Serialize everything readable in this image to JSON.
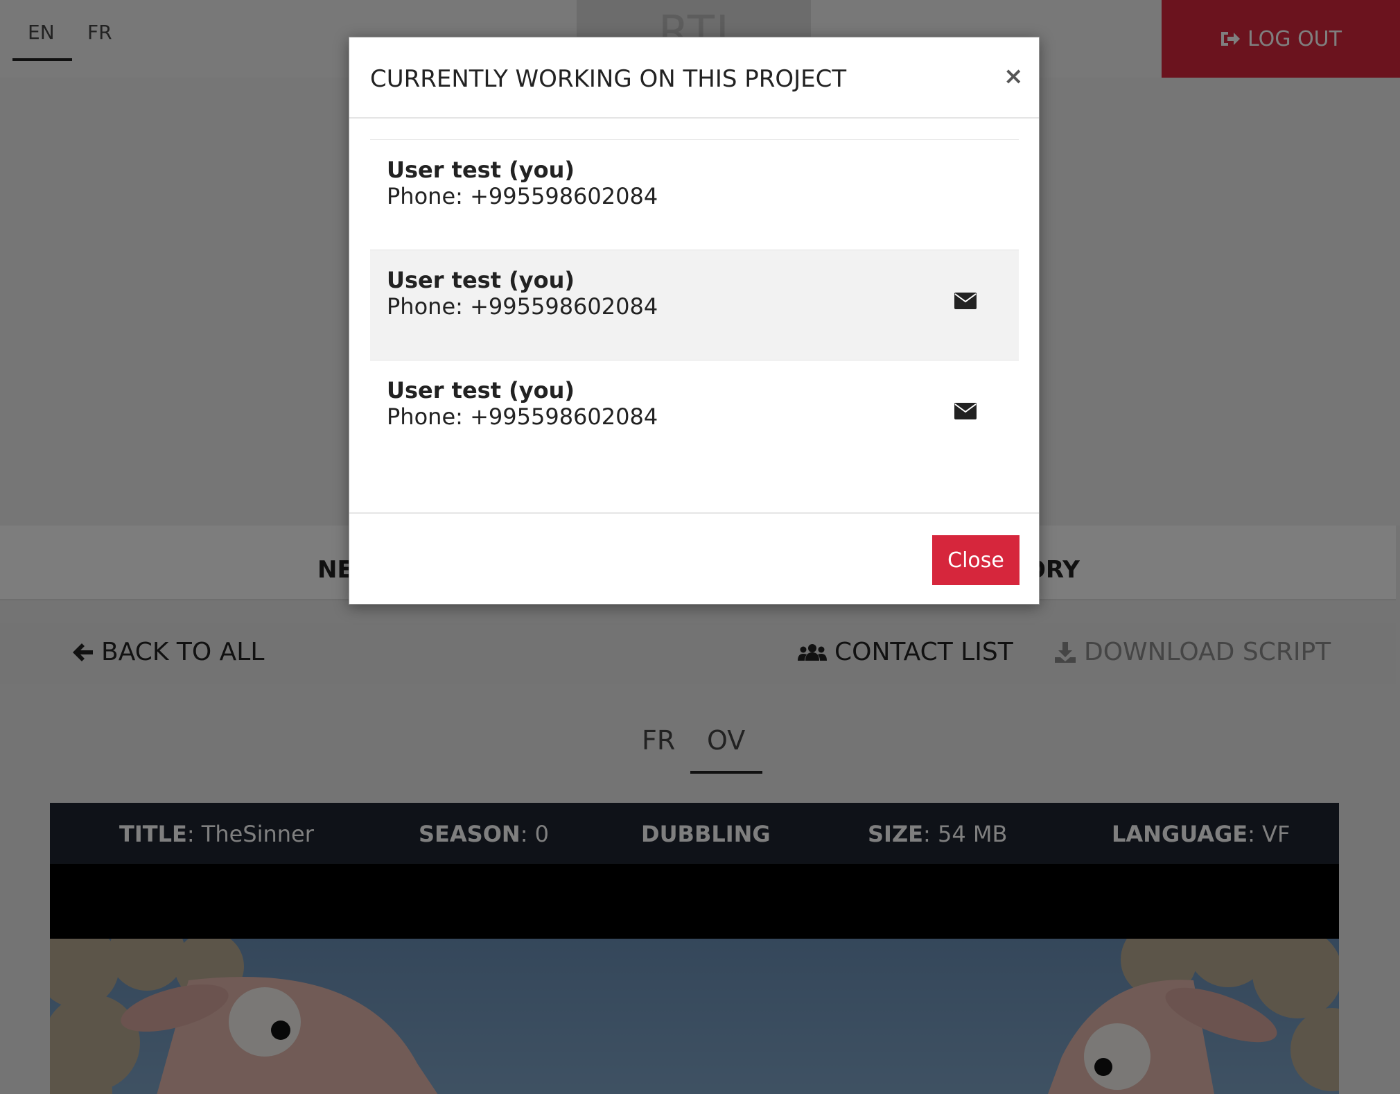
{
  "header": {
    "languages": [
      "EN",
      "FR"
    ],
    "logo_text": "RTI",
    "logout_label": "LOG OUT"
  },
  "tabs": {
    "left_partial": "NE",
    "right_partial": "ORY"
  },
  "actions": {
    "back_label": "BACK TO ALL",
    "contact_label": "CONTACT LIST",
    "download_label": "DOWNLOAD SCRIPT"
  },
  "versions": [
    "FR",
    "OV"
  ],
  "info": {
    "title_label": "TITLE",
    "title_value": "TheSinner",
    "season_label": "SEASON",
    "season_value": "0",
    "type_label": "DUBBLING",
    "size_label": "SIZE",
    "size_value": "54 MB",
    "language_label": "LANGUAGE",
    "language_value": "VF"
  },
  "modal": {
    "title": "CURRENTLY WORKING ON THIS PROJECT",
    "close_x": "×",
    "close_label": "Close",
    "users": [
      {
        "name": "User test (you)",
        "phone": "Phone: +995598602084"
      },
      {
        "name": "User test (you)",
        "phone": "Phone: +995598602084"
      },
      {
        "name": "User test (you)",
        "phone": "Phone: +995598602084"
      }
    ]
  },
  "colors": {
    "accent": "#d6263c",
    "infobar": "#1e2530"
  }
}
